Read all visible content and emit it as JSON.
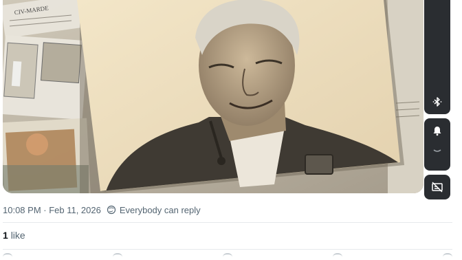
{
  "post": {
    "timestamp": "10:08 PM · Feb 11, 2026",
    "reply_setting": "Everybody can reply",
    "likes_count": "1",
    "likes_label": "like"
  },
  "media": {
    "collage_clip_text": "CIV-MARDE"
  },
  "side_controls": [
    {
      "icon": "bluetooth-icon"
    },
    {
      "icon": "bell-icon"
    },
    {
      "icon": "chevron-down-icon"
    },
    {
      "icon": "captions-off-icon"
    }
  ],
  "colors": {
    "meta_text": "#536471",
    "primary_text": "#0f1419",
    "divider": "#e6e9ec",
    "control_bg": "#2a2d31",
    "photo_bg": "#ede0c4"
  }
}
